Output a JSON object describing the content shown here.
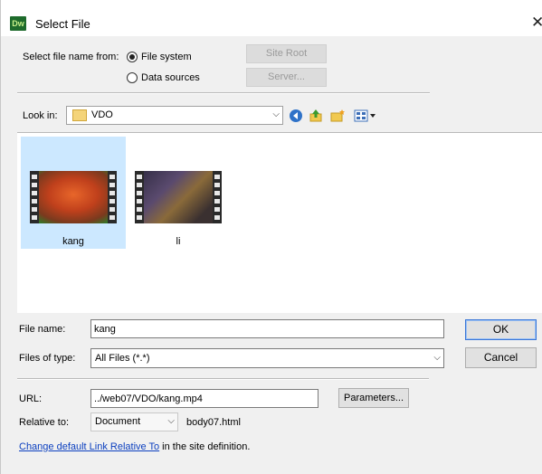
{
  "window": {
    "title": "Select File",
    "app_badge": "Dw",
    "close_glyph": "✕"
  },
  "select_from": {
    "label": "Select file name from:",
    "options": [
      {
        "label": "File system",
        "checked": true
      },
      {
        "label": "Data sources",
        "checked": false
      }
    ],
    "site_root_label": "Site Root",
    "server_label": "Server..."
  },
  "look_in": {
    "label": "Look in:",
    "value": "VDO"
  },
  "files": [
    {
      "name": "kang",
      "selected": true
    },
    {
      "name": "li",
      "selected": false
    }
  ],
  "file_name": {
    "label": "File name:",
    "value": "kang"
  },
  "files_of_type": {
    "label": "Files of type:",
    "value": "All Files (*.*)"
  },
  "ok_label": "OK",
  "cancel_label": "Cancel",
  "url": {
    "label": "URL:",
    "value": "../web07/VDO/kang.mp4"
  },
  "parameters_label": "Parameters...",
  "relative_to": {
    "label": "Relative to:",
    "value": "Document",
    "doc": "body07.html"
  },
  "footer": {
    "link_text": "Change default Link Relative To",
    "suffix": " in the site definition."
  },
  "icons": [
    "back-icon",
    "up-folder-icon",
    "new-folder-icon",
    "view-menu-icon"
  ],
  "colors": {
    "selection": "#cce8ff",
    "link": "#0b3fbf",
    "default_button_border": "#3a76d6"
  }
}
